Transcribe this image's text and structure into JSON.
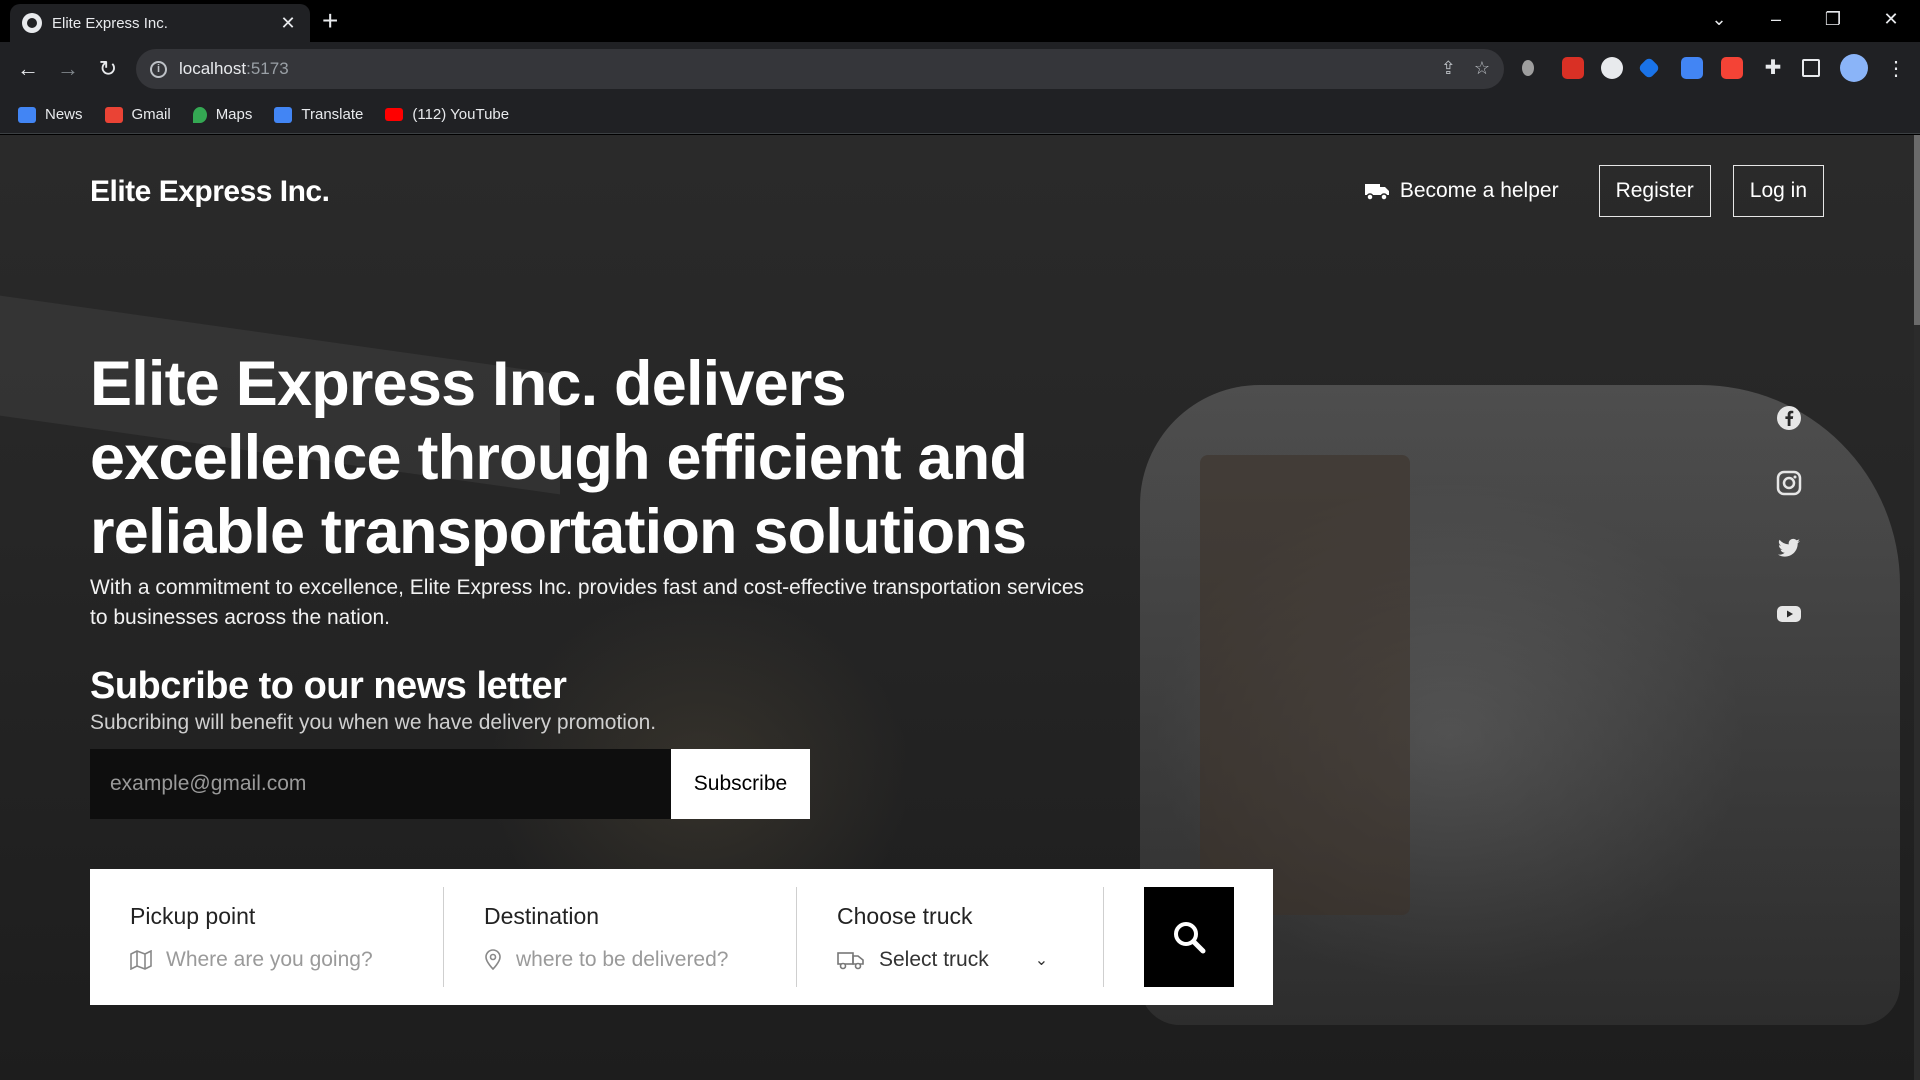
{
  "browser": {
    "tab_title": "Elite Express Inc.",
    "url_host": "localhost",
    "url_port": ":5173",
    "bookmarks": [
      {
        "label": "News",
        "color": "#4285f4"
      },
      {
        "label": "Gmail",
        "color": "#ea4335"
      },
      {
        "label": "Maps",
        "color": "#34a853"
      },
      {
        "label": "Translate",
        "color": "#4285f4"
      },
      {
        "label": "(112) YouTube",
        "color": "#ff0000"
      }
    ]
  },
  "site": {
    "brand": "Elite Express Inc.",
    "become_helper": "Become a helper",
    "register": "Register",
    "login": "Log in"
  },
  "hero": {
    "title": "Elite Express Inc. delivers excellence through efficient and reliable transportation solutions",
    "subtitle": "With a commitment to excellence, Elite Express Inc. provides fast and cost-effective transportation services to businesses across the nation."
  },
  "newsletter": {
    "title": "Subcribe to our news letter",
    "subtitle": "Subcribing will benefit you when we have delivery promotion.",
    "email_placeholder": "example@gmail.com",
    "button": "Subscribe"
  },
  "social": [
    "facebook-icon",
    "instagram-icon",
    "twitter-icon",
    "youtube-icon"
  ],
  "search": {
    "pickup_label": "Pickup point",
    "pickup_placeholder": "Where are you going?",
    "destination_label": "Destination",
    "destination_placeholder": "where to be delivered?",
    "truck_label": "Choose truck",
    "truck_value": "Select truck"
  }
}
